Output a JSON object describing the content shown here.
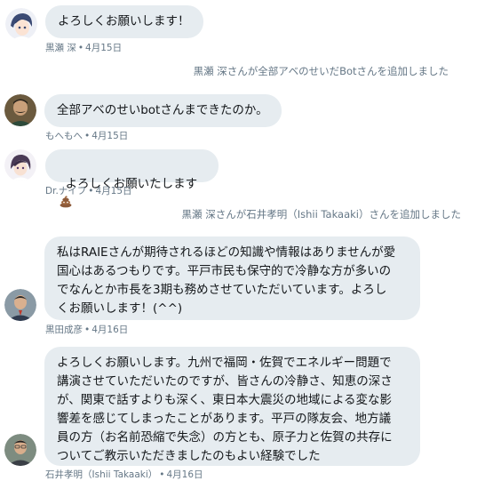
{
  "messages": [
    {
      "text": "よろしくお願いします！",
      "sender": "黒瀬 深",
      "date": "4月15日"
    },
    {
      "text": "全部アベのせいbotさんまできたのか。",
      "sender": "もへもへ",
      "date": "4月15日"
    },
    {
      "text": "よろしくお願いたします",
      "sender": "Dr.ナイフ",
      "date": "4月15日"
    },
    {
      "text": "私はRAIEさんが期待されるほどの知識や情報はありませんが愛\n国心はあるつもりです。平戸市民も保守的で冷静な方が多いの\nでなんとか市長を3期も務めさせていただいています。よろし\nくお願いします！(^^)",
      "sender": "黒田成彦",
      "date": "4月16日"
    },
    {
      "text": "よろしくお願いします。九州で福岡・佐賀でエネルギー問題で\n講演させていただいたのですが、皆さんの冷静さ、知恵の深さ\nが、関東で話すよりも深く、東日本大震災の地域による変な影\n響差を感じてしまったことがあります。平戸の隊友会、地方議\n員の方（お名前恐縮で失念）の方とも、原子力と佐賀の共存に\nついてご教示いただきましたのもよい経験でした",
      "sender": "石井孝明（Ishii Takaaki）",
      "date": "4月16日"
    }
  ],
  "system": [
    "黒瀬 深さんが全部アベのせいだBotさんを追加しました",
    "黒瀬 深さんが石井孝明（Ishii Takaaki）さんを追加しました"
  ],
  "meta_separator": "•",
  "emoji": "poop-emoji"
}
